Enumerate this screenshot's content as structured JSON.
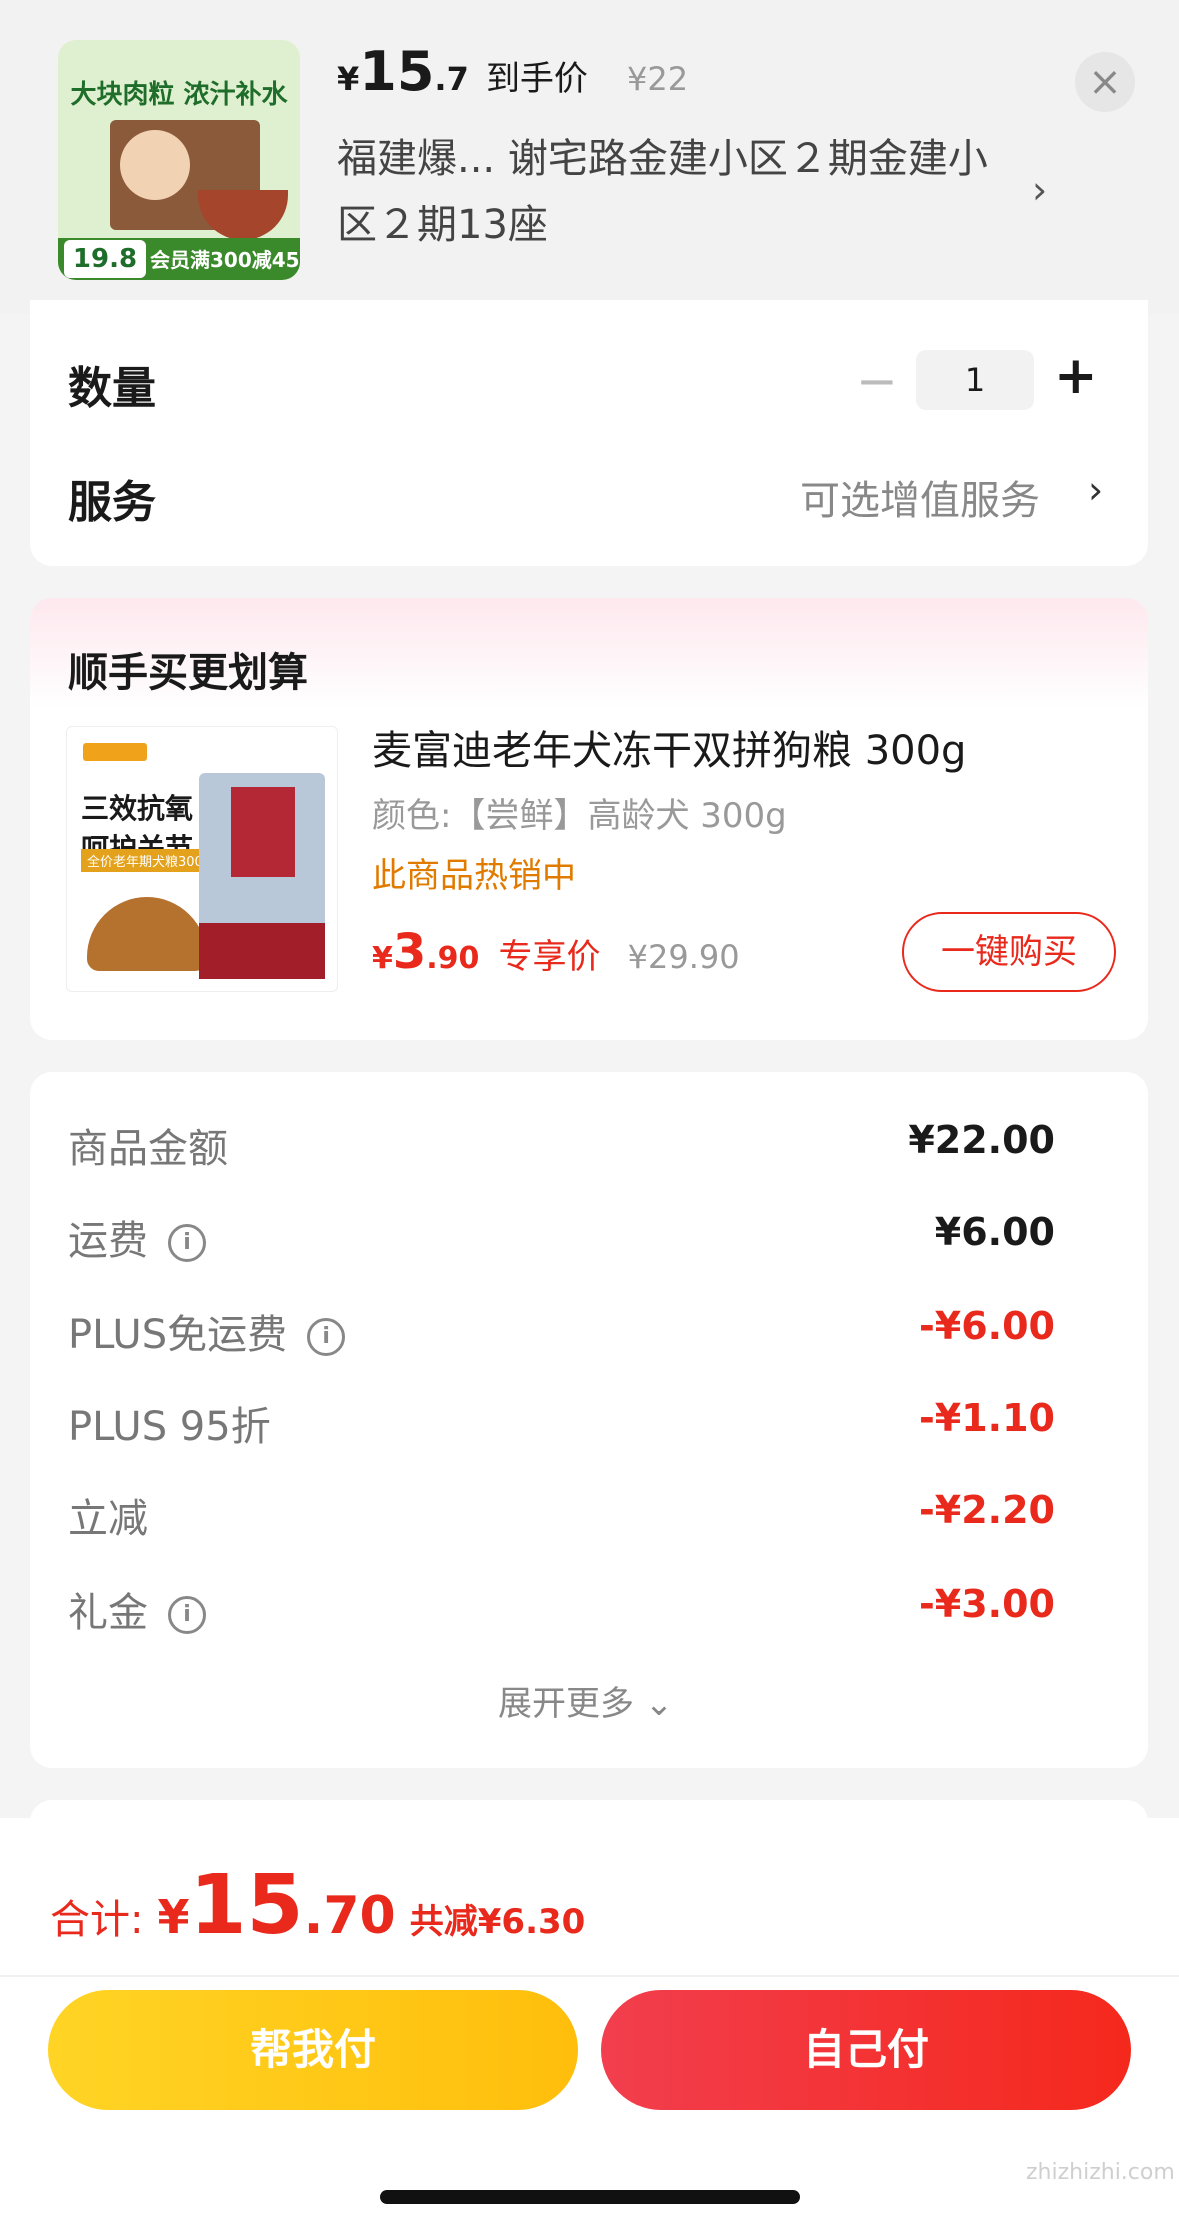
{
  "header": {
    "thumb": {
      "banner": "大块肉粒 浓汁补水",
      "price": "19.8",
      "promo": "会员满300减45"
    },
    "price_symbol": "¥",
    "price_int": "15",
    "price_dec": ".7",
    "price_tag": "到手价",
    "original_price": "¥22",
    "address": "福建爆...  谢宅路金建小区２期金建小区２期13座",
    "arrow": "›",
    "close": "×"
  },
  "quantity": {
    "label": "数量",
    "minus": "−",
    "value": "1",
    "plus": "+"
  },
  "service": {
    "label": "服务",
    "value": "可选增值服务",
    "arrow": "›"
  },
  "addon": {
    "title": "顺手买更划算",
    "image_text": "三效抗氧 呵护关节",
    "image_sub": "全价老年期犬粮300g",
    "name": "麦富迪老年犬冻干双拼狗粮 300g",
    "spec": "颜色:【尝鲜】高龄犬 300g",
    "hot": "此商品热销中",
    "price_symbol": "¥",
    "price_int": "3",
    "price_dec": ".90",
    "price_tag": "专享价",
    "original_price": "¥29.90",
    "buy_label": "一键购买"
  },
  "fees": [
    {
      "label": "商品金额",
      "value": "¥22.00",
      "info": false,
      "red": false
    },
    {
      "label": "运费",
      "value": "¥6.00",
      "info": true,
      "red": false
    },
    {
      "label": "PLUS免运费",
      "value": "-¥6.00",
      "info": true,
      "red": true
    },
    {
      "label": "PLUS 95折",
      "value": "-¥1.10",
      "info": false,
      "red": true
    },
    {
      "label": "立减",
      "value": "-¥2.20",
      "info": false,
      "red": true
    },
    {
      "label": "礼金",
      "value": "-¥3.00",
      "info": true,
      "red": true
    }
  ],
  "expand_label": "展开更多 ⌄",
  "total": {
    "label": "合计:",
    "symbol": "¥",
    "int": "15",
    "dec": ".70",
    "saved": "共减¥6.30"
  },
  "buttons": {
    "help_pay": "帮我付",
    "self_pay": "自己付"
  },
  "watermark": "zhizhizhi.com",
  "colors": {
    "accent_red": "#e8291c",
    "accent_yellow": "#ffc81a",
    "hot_orange": "#e07b00"
  }
}
